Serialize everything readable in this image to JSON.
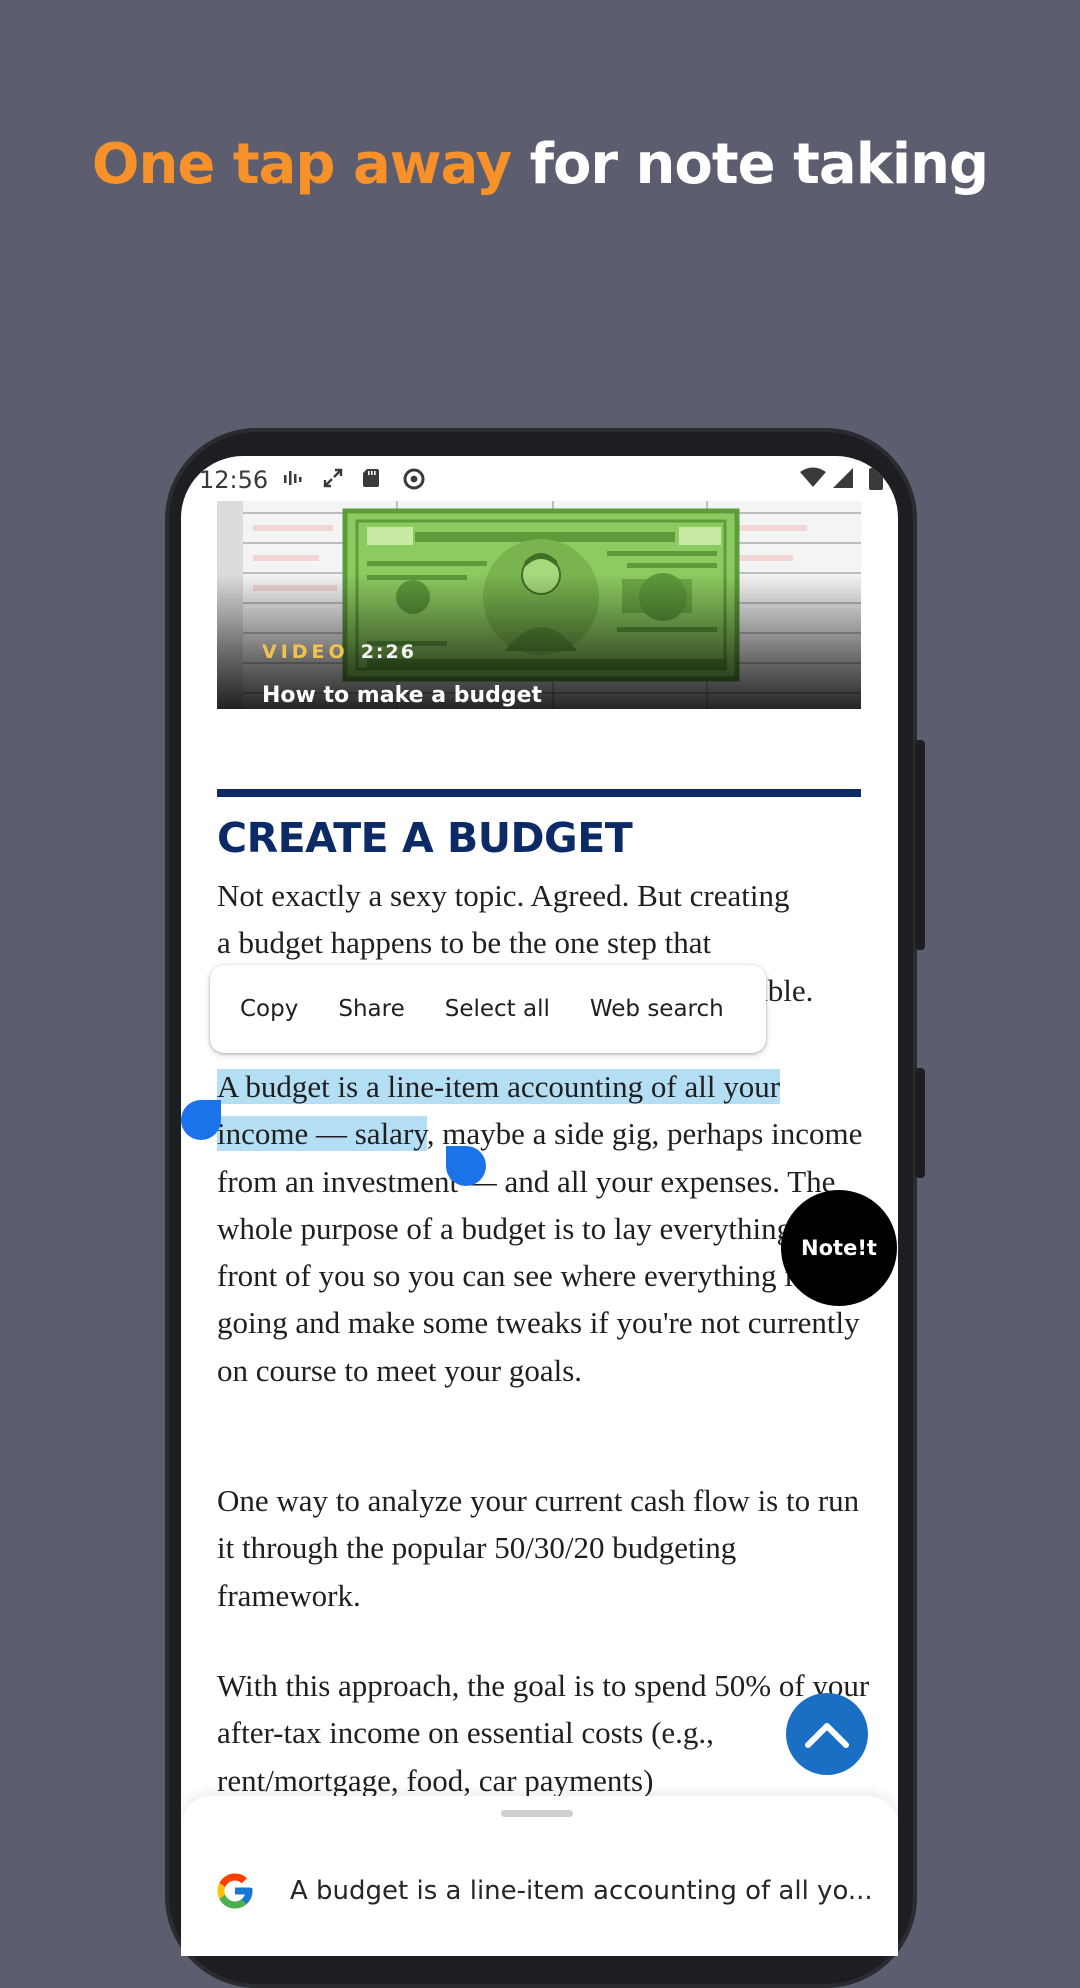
{
  "headline": {
    "accent": "One tap away",
    "rest": "for note taking"
  },
  "colors": {
    "accent": "#f7912a",
    "background": "#5c5d6f",
    "selection": "#b4def3",
    "handle": "#1a73e8",
    "heading": "#0b2a66"
  },
  "statusbar": {
    "time": "12:56",
    "left_icons": [
      "activity-icon",
      "rotate-icon",
      "sd-card-icon",
      "data-saver-icon"
    ],
    "right_icons": [
      "wifi-icon",
      "signal-icon",
      "battery-icon"
    ]
  },
  "video": {
    "tag": "VIDEO",
    "duration": "2:26",
    "title": "How to make a budget"
  },
  "article": {
    "heading": "CREATE A BUDGET",
    "p1_line1": "Not exactly a sexy topic. Agreed. But creating",
    "p1_line2": "a budget happens to be the one step that",
    "p1_line3_visible": "able.",
    "p2_selected_1": "A budget is a line-item accounting of all your",
    "p2_selected_2": "income — salary",
    "p2_rest": ", maybe a side gig, perhaps income from an investment — and all your expenses. The whole purpose of a budget is to lay everything out in front of you so you can see where everything is going and make some tweaks if you're not currently on course to meet your goals.",
    "p3": "One way to analyze your current cash flow is to run it through the popular 50/30/20 budgeting framework.",
    "p4": "With this approach, the goal is to spend 50% of your after-tax income on essential costs (e.g., rent/mortgage, food, car payments)"
  },
  "context_menu": {
    "items": [
      "Copy",
      "Share",
      "Select all",
      "Web search"
    ]
  },
  "noteit_button": "Note!t",
  "scroll_top_icon": "chevron-up-icon",
  "bottom_sheet": {
    "query": "A budget is a line-item accounting of all yo..."
  }
}
